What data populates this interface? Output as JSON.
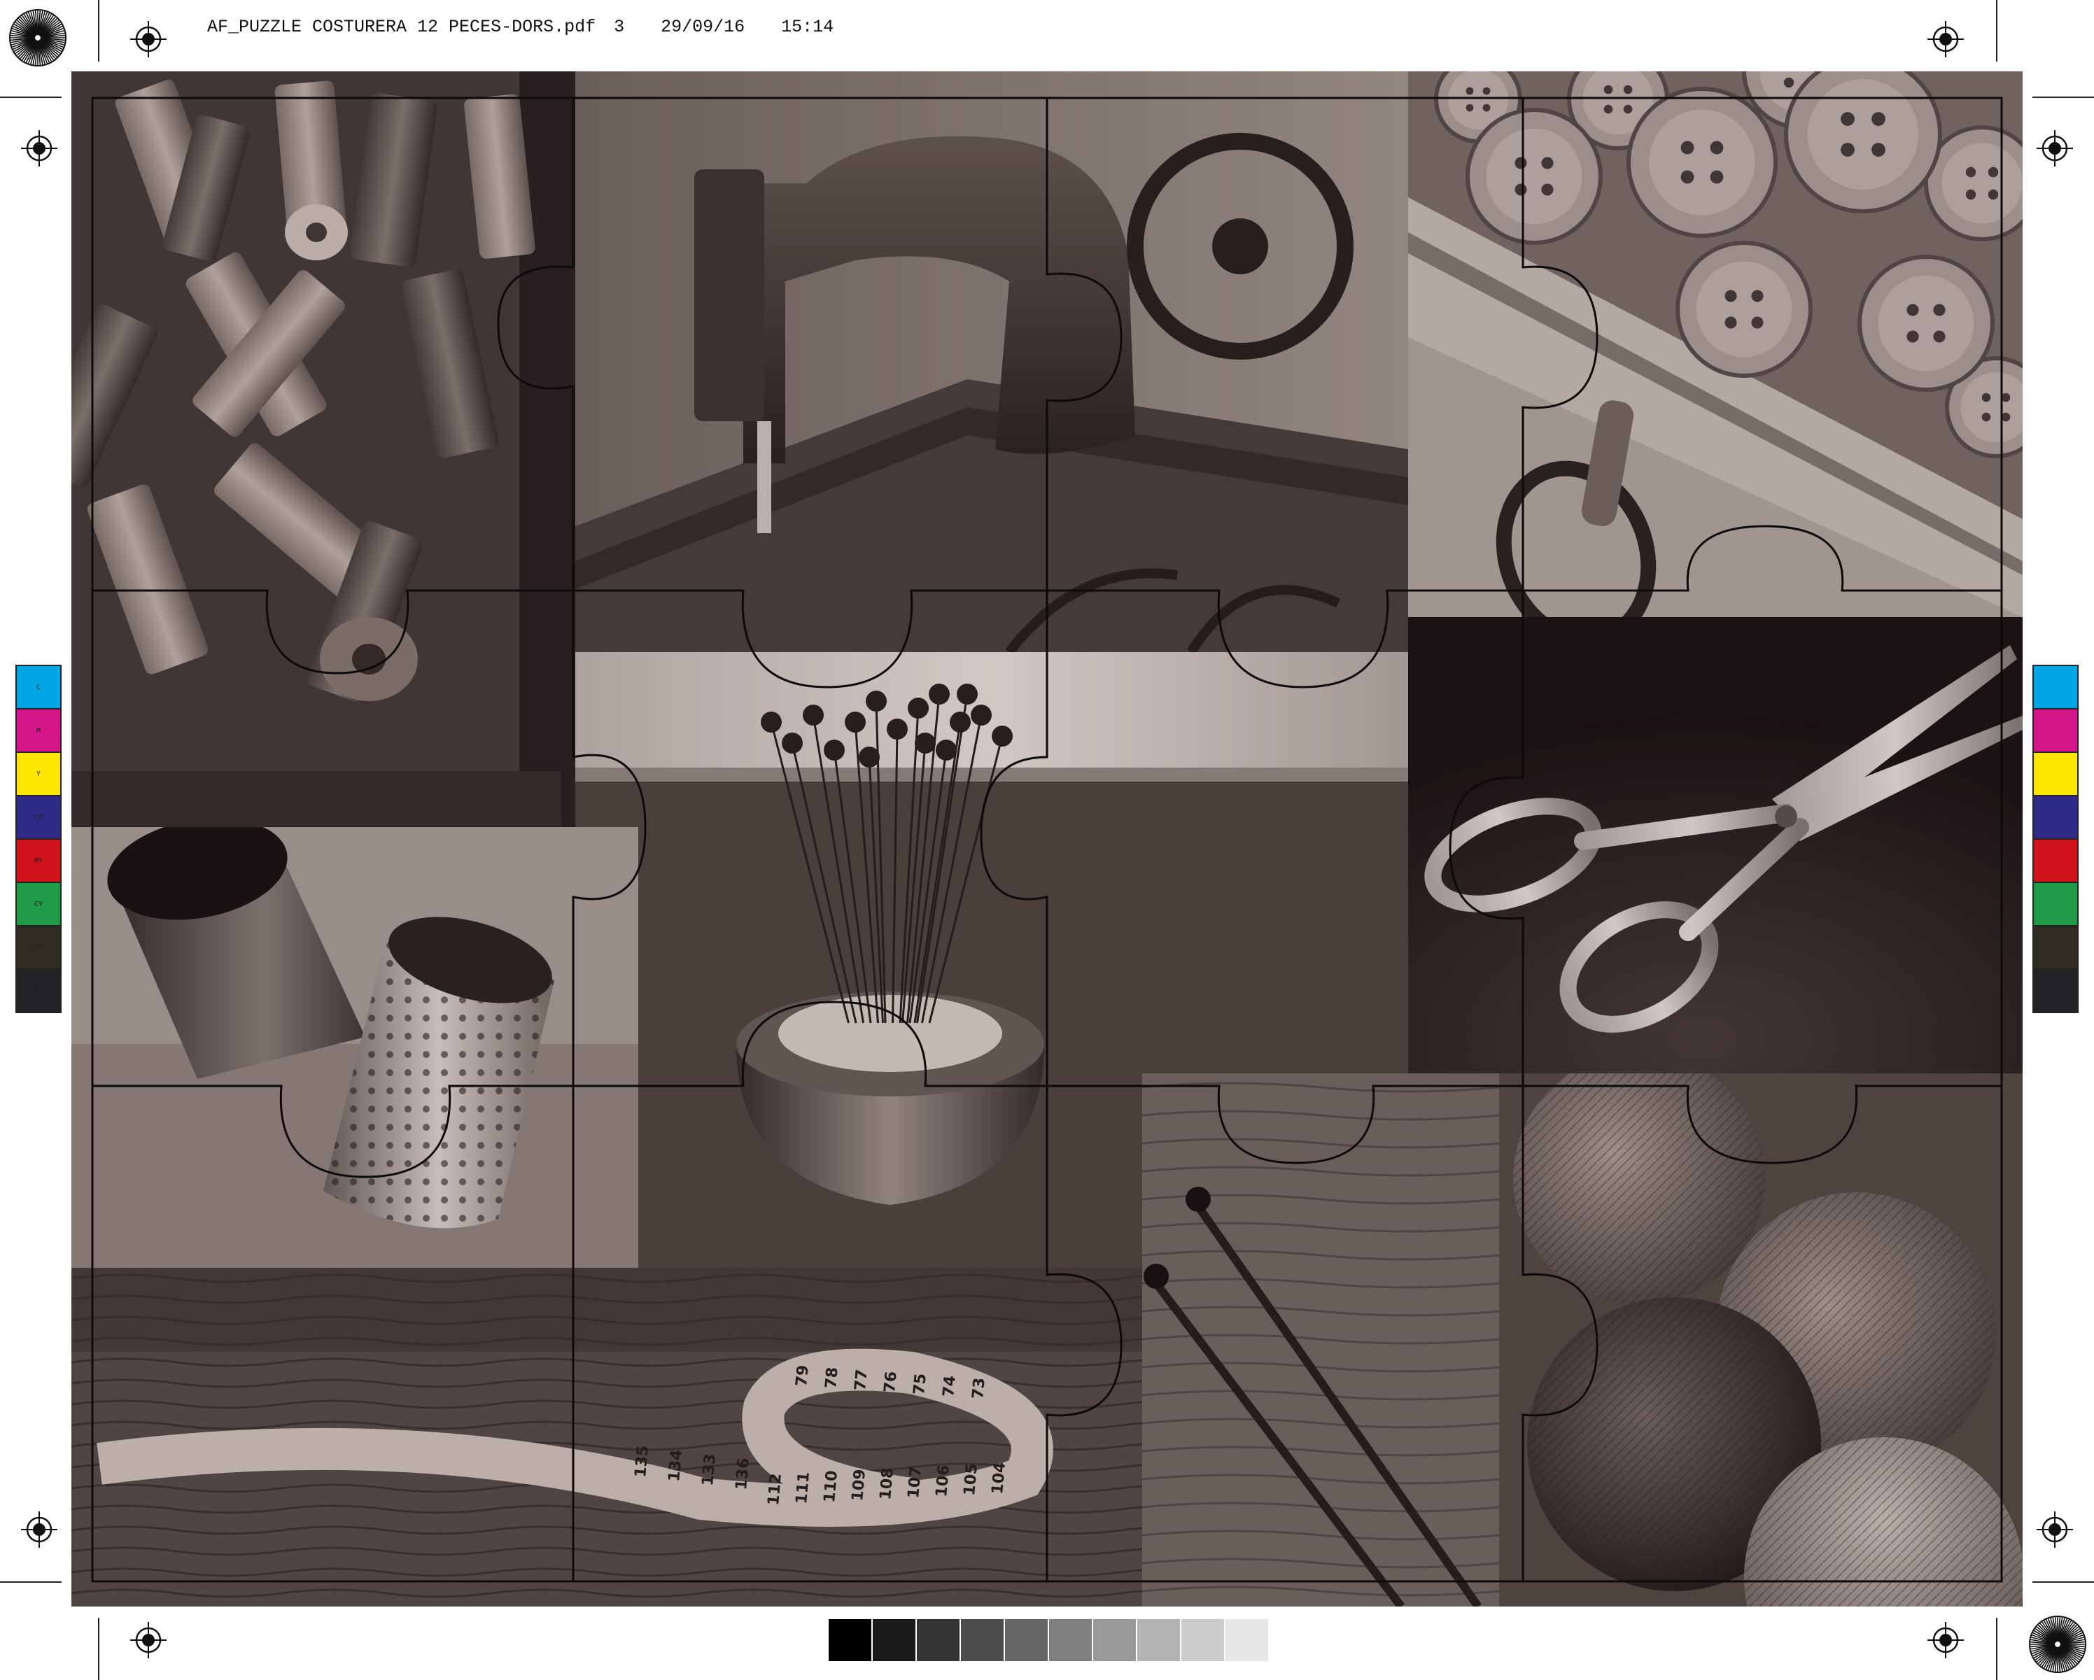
{
  "slug": {
    "filename": "AF_PUZZLE COSTURERA 12 PECES-DORS.pdf",
    "page": "3",
    "date": "29/09/16",
    "time": "15:14"
  },
  "color_bar_left": [
    "C",
    "M",
    "Y",
    "CM",
    "MY",
    "CY",
    "CMY",
    "K"
  ],
  "color_bar_right": [
    "",
    "",
    "",
    "",
    "",
    "",
    "",
    ""
  ],
  "patch_colors": [
    "#00a6e4",
    "#d6178c",
    "#ffe600",
    "#2d2b86",
    "#d0131a",
    "#1f9a46",
    "#302c24",
    "#222327"
  ],
  "gray_steps": [
    "#000000",
    "#1a1a1a",
    "#333333",
    "#4d4d4d",
    "#666666",
    "#808080",
    "#999999",
    "#b3b3b3",
    "#cccccc",
    "#e6e6e6"
  ],
  "icons": [
    "registration-mark-icon",
    "starburst-icon",
    "thread-spools-icon",
    "sewing-machine-icon",
    "buttons-icon",
    "pin-cushion-icon",
    "scissors-icon",
    "thimble-icon",
    "measuring-tape-icon",
    "knitting-needles-icon",
    "yarn-balls-icon"
  ],
  "tape_numbers": [
    "135",
    "134",
    "133",
    "136",
    "112",
    "111",
    "110",
    "109",
    "108",
    "107",
    "106",
    "105",
    "104",
    "79",
    "78",
    "77",
    "76",
    "75",
    "74",
    "73"
  ]
}
